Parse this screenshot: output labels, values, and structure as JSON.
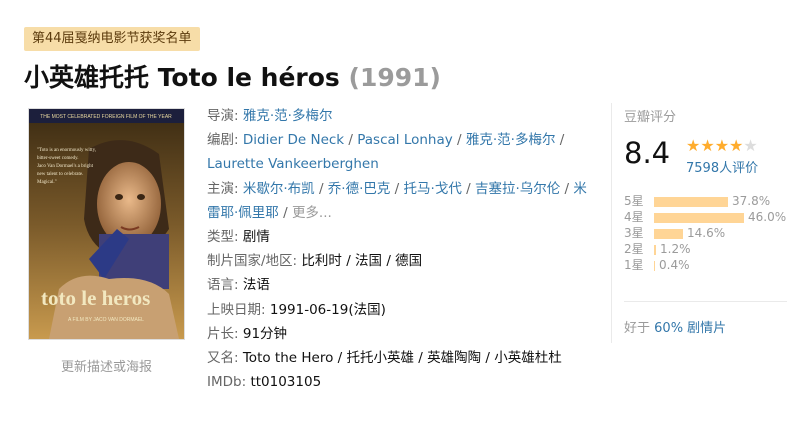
{
  "award_tag": "第44届戛纳电影节获奖名单",
  "title": {
    "main": "小英雄托托 Toto le héros",
    "year": "(1991)"
  },
  "poster": {
    "top_text": "THE MOST CELEBRATED FOREIGN FILM OF THE YEAR",
    "quote": "\"Toto is an enormously witty, bitter-sweet comedy. Jaco Van Dormael is a bright new talent to celebrate. Magical.\"",
    "film_title": "toto le heros",
    "credit": "A FILM BY JACO VAN DORMAEL",
    "update_link": "更新描述或海报"
  },
  "info": {
    "director_label": "导演:",
    "director": "雅克·范·多梅尔",
    "writer_label": "编剧:",
    "writers": [
      "Didier De Neck",
      "Pascal Lonhay",
      "雅克·范·多梅尔",
      "Laurette Vankeerberghen"
    ],
    "cast_label": "主演:",
    "cast": [
      "米歇尔·布凯",
      "乔·德·巴克",
      "托马·戈代",
      "吉塞拉·乌尔伦",
      "米雷耶·佩里耶"
    ],
    "cast_more": "更多...",
    "genre_label": "类型:",
    "genre": "剧情",
    "country_label": "制片国家/地区:",
    "country": "比利时 / 法国 / 德国",
    "language_label": "语言:",
    "language": "法语",
    "release_label": "上映日期:",
    "release": "1991-06-19(法国)",
    "runtime_label": "片长:",
    "runtime": "91分钟",
    "aka_label": "又名:",
    "aka": "Toto the Hero / 托托小英雄 / 英雄陶陶 / 小英雄杜杜",
    "imdb_label": "IMDb:",
    "imdb": "tt0103105"
  },
  "rating": {
    "header": "豆瓣评分",
    "score": "8.4",
    "stars_filled": 4,
    "votes": "7598人评价",
    "distribution": [
      {
        "label": "5星",
        "percent": 37.8,
        "text": "37.8%"
      },
      {
        "label": "4星",
        "percent": 46.0,
        "text": "46.0%"
      },
      {
        "label": "3星",
        "percent": 14.6,
        "text": "14.6%"
      },
      {
        "label": "2星",
        "percent": 1.2,
        "text": "1.2%"
      },
      {
        "label": "1星",
        "percent": 0.4,
        "text": "0.4%"
      }
    ],
    "better_prefix": "好于",
    "better_link": "60% 剧情片"
  },
  "colors": {
    "link": "#3377aa",
    "star": "#ffac2d",
    "bar": "#ffd596",
    "tag_bg": "#f7dda8"
  }
}
